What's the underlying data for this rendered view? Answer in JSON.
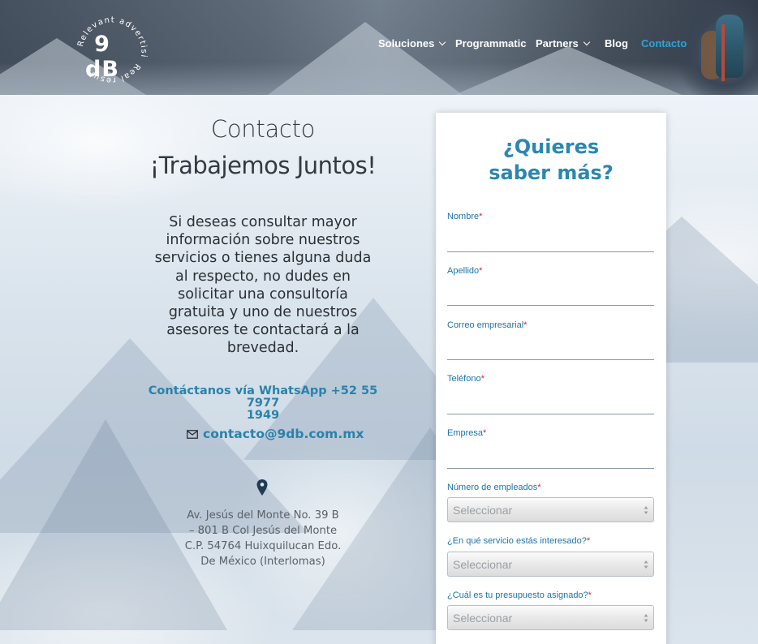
{
  "header": {
    "logo_text": "9 dB",
    "logo_ring_top": "Relevant advertising",
    "logo_ring_bottom": "Real results",
    "nav": [
      {
        "label": "Soluciones",
        "has_dropdown": true,
        "active": false
      },
      {
        "label": "Programmatic",
        "has_dropdown": false,
        "active": false
      },
      {
        "label": "Partners",
        "has_dropdown": true,
        "active": false
      },
      {
        "label": "Blog",
        "has_dropdown": false,
        "active": false
      },
      {
        "label": "Contacto",
        "has_dropdown": false,
        "active": true
      }
    ],
    "active_color": "#2ea3d5"
  },
  "left": {
    "title": "Contacto",
    "subtitle": "¡Trabajemos Juntos!",
    "description": "Si deseas consultar mayor información sobre nuestros servicios o tienes alguna duda al respecto, no dudes en solicitar una consultoría gratuita y uno de nuestros asesores te contactará a la brevedad.",
    "whatsapp_line1": "Contáctanos vía WhatsApp +52 55 7977",
    "whatsapp_line2": "1949",
    "email": "contacto@9db.com.mx",
    "email_icon": "envelope-icon",
    "location_icon": "map-pin-icon",
    "address": "Av. Jesús del Monte No. 39 B – 801 B Col Jesús del Monte C.P. 54764 Huixquilucan Edo. De México (Interlomas)"
  },
  "form": {
    "title_line1": "¿Quieres",
    "title_line2": "saber más?",
    "required_mark": "*",
    "fields": {
      "nombre": {
        "label": "Nombre",
        "value": ""
      },
      "apellido": {
        "label": "Apellido",
        "value": ""
      },
      "correo": {
        "label": "Correo empresarial",
        "value": ""
      },
      "telefono": {
        "label": "Teléfono",
        "value": ""
      },
      "empresa": {
        "label": "Empresa",
        "value": ""
      }
    },
    "selects": {
      "empleados": {
        "label": "Número de empleados",
        "value": "Seleccionar"
      },
      "servicio": {
        "label": "¿En qué servicio estás interesado?",
        "value": "Seleccionar"
      },
      "presupuesto": {
        "label": "¿Cuál es tu presupuesto asignado?",
        "value": "Seleccionar"
      }
    }
  },
  "colors": {
    "brand_blue": "#2b87b0",
    "label_blue": "#1d73a8",
    "required_red": "#e0212b"
  }
}
